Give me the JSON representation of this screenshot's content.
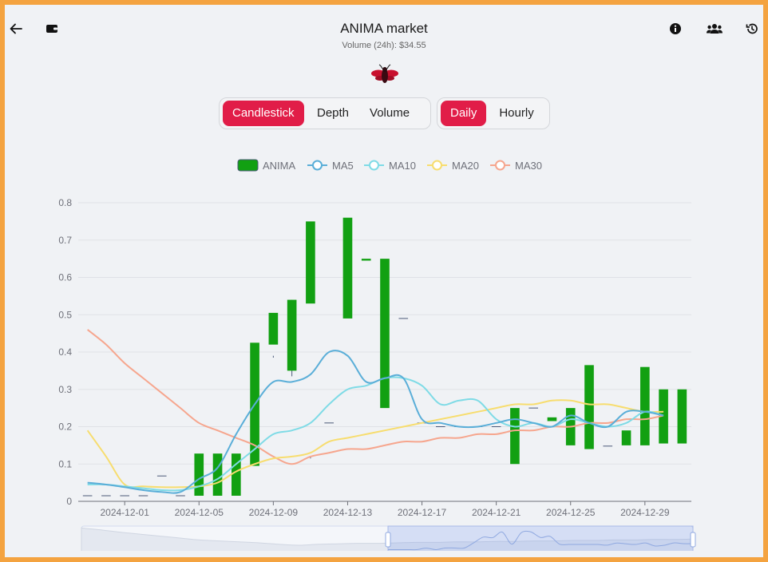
{
  "header": {
    "title": "ANIMA market",
    "volume_label": "Volume (24h): $34.55"
  },
  "chart_tabs": [
    "Candlestick",
    "Depth",
    "Volume"
  ],
  "interval_tabs": [
    "Daily",
    "Hourly"
  ],
  "active_chart_tab": "Candlestick",
  "active_interval_tab": "Daily",
  "colors": {
    "up": "#12a012",
    "down": "#e0103e",
    "accent": "#e11d48",
    "ma5": "#5aaed8",
    "ma10": "#7fdbe6",
    "ma20": "#f7dd6f",
    "ma30": "#f6a68e",
    "frame": "#f4a340"
  },
  "icons": {
    "back": "arrow-left-icon",
    "wallet": "wallet-icon",
    "info": "info-icon",
    "users": "users-icon",
    "history": "history-icon"
  },
  "chart_data": {
    "type": "candlestick",
    "legend": [
      "ANIMA",
      "MA5",
      "MA10",
      "MA20",
      "MA30"
    ],
    "legend_position": "top-center",
    "grid": true,
    "ylim": [
      0,
      0.8
    ],
    "yticks": [
      "0",
      "0.1",
      "0.2",
      "0.3",
      "0.4",
      "0.5",
      "0.6",
      "0.7",
      "0.8"
    ],
    "xticks": [
      "2024-12-01",
      "2024-12-05",
      "2024-12-09",
      "2024-12-13",
      "2024-12-17",
      "2024-12-21",
      "2024-12-25",
      "2024-12-29"
    ],
    "dates": [
      "2024-11-29",
      "2024-11-30",
      "2024-12-01",
      "2024-12-02",
      "2024-12-03",
      "2024-12-04",
      "2024-12-05",
      "2024-12-06",
      "2024-12-07",
      "2024-12-08",
      "2024-12-09",
      "2024-12-10",
      "2024-12-11",
      "2024-12-12",
      "2024-12-13",
      "2024-12-14",
      "2024-12-15",
      "2024-12-16",
      "2024-12-17",
      "2024-12-18",
      "2024-12-19",
      "2024-12-20",
      "2024-12-21",
      "2024-12-22",
      "2024-12-23",
      "2024-12-24",
      "2024-12-25",
      "2024-12-26",
      "2024-12-27",
      "2024-12-28",
      "2024-12-29",
      "2024-12-30"
    ],
    "ohlc": [
      [
        0.015,
        0.015,
        0.015,
        0.015
      ],
      [
        0.015,
        0.015,
        0.015,
        0.015
      ],
      [
        0.015,
        0.015,
        0.015,
        0.015
      ],
      [
        0.015,
        0.015,
        0.015,
        0.015
      ],
      [
        0.068,
        0.068,
        0.068,
        0.068
      ],
      [
        0.015,
        0.015,
        0.015,
        0.015
      ],
      [
        0.015,
        0.128,
        0.015,
        0.128
      ],
      [
        0.015,
        0.128,
        0.015,
        0.128
      ],
      [
        0.015,
        0.128,
        0.015,
        0.128
      ],
      [
        0.095,
        0.425,
        0.095,
        0.425
      ],
      [
        0.42,
        0.505,
        0.385,
        0.39
      ],
      [
        0.35,
        0.54,
        0.335,
        0.54
      ],
      [
        0.53,
        0.75,
        0.115,
        0.12
      ],
      [
        0.21,
        0.21,
        0.21,
        0.21
      ],
      [
        0.49,
        0.76,
        0.49,
        0.76
      ],
      [
        0.645,
        0.65,
        0.25,
        0.25
      ],
      [
        0.25,
        0.65,
        0.25,
        0.25
      ],
      [
        0.49,
        0.49,
        0.21,
        0.21
      ],
      [
        0.21,
        0.21,
        0.2,
        0.2
      ],
      [
        0.2,
        0.2,
        0.2,
        0.2
      ],
      [
        0.2,
        0.2,
        0.2,
        0.2
      ],
      [
        0.2,
        0.2,
        0.2,
        0.2
      ],
      [
        0.2,
        0.2,
        0.2,
        0.2
      ],
      [
        0.1,
        0.25,
        0.1,
        0.25
      ],
      [
        0.25,
        0.25,
        0.25,
        0.25
      ],
      [
        0.215,
        0.225,
        0.14,
        0.14
      ],
      [
        0.15,
        0.25,
        0.14,
        0.14
      ],
      [
        0.14,
        0.365,
        0.14,
        0.365
      ],
      [
        0.148,
        0.148,
        0.148,
        0.148
      ],
      [
        0.15,
        0.19,
        0.15,
        0.19
      ],
      [
        0.15,
        0.36,
        0.15,
        0.36
      ],
      [
        0.155,
        0.3,
        0.155,
        0.155
      ],
      [
        0.155,
        0.3,
        0.155,
        0.3
      ]
    ],
    "ma5": [
      0.05,
      0.045,
      0.038,
      0.03,
      0.025,
      0.025,
      0.06,
      0.09,
      0.18,
      0.26,
      0.32,
      0.32,
      0.34,
      0.4,
      0.39,
      0.32,
      0.33,
      0.33,
      0.22,
      0.21,
      0.2,
      0.2,
      0.21,
      0.22,
      0.21,
      0.2,
      0.23,
      0.21,
      0.2,
      0.24,
      0.24,
      0.23
    ],
    "ma10": [
      0.045,
      0.045,
      0.04,
      0.035,
      0.03,
      0.03,
      0.04,
      0.06,
      0.1,
      0.14,
      0.18,
      0.19,
      0.21,
      0.26,
      0.3,
      0.31,
      0.33,
      0.33,
      0.31,
      0.26,
      0.27,
      0.27,
      0.22,
      0.2,
      0.21,
      0.2,
      0.22,
      0.21,
      0.2,
      0.21,
      0.24,
      0.23
    ],
    "ma20": [
      0.19,
      0.12,
      0.045,
      0.04,
      0.038,
      0.038,
      0.04,
      0.05,
      0.08,
      0.1,
      0.115,
      0.12,
      0.13,
      0.16,
      0.17,
      0.18,
      0.19,
      0.2,
      0.21,
      0.22,
      0.23,
      0.24,
      0.25,
      0.26,
      0.26,
      0.27,
      0.27,
      0.26,
      0.26,
      0.25,
      0.24,
      0.24
    ],
    "ma30": [
      0.46,
      0.42,
      0.37,
      0.33,
      0.29,
      0.25,
      0.21,
      0.19,
      0.17,
      0.15,
      0.12,
      0.1,
      0.12,
      0.13,
      0.14,
      0.14,
      0.15,
      0.16,
      0.16,
      0.17,
      0.17,
      0.18,
      0.18,
      0.19,
      0.19,
      0.2,
      0.2,
      0.21,
      0.21,
      0.22,
      0.22,
      0.23
    ]
  }
}
